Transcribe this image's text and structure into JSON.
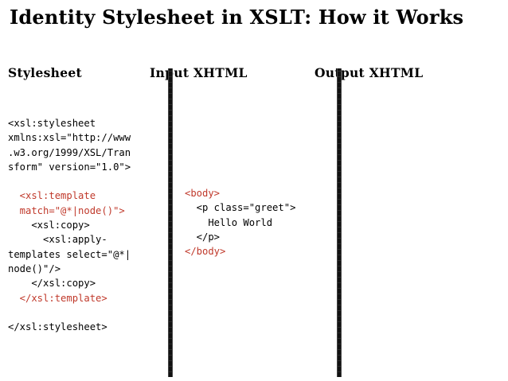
{
  "title": "Identity Stylesheet in XSLT: How it Works",
  "columns": {
    "stylesheet": "Stylesheet",
    "input": "Input XHTML",
    "output": "Output XHTML"
  },
  "stylesheet_code": [
    {
      "text": "<xsl:stylesheet",
      "highlight": false
    },
    {
      "text": "xmlns:xsl=\"http://www",
      "highlight": false
    },
    {
      "text": ".w3.org/1999/XSL/Tran",
      "highlight": false
    },
    {
      "text": "sform\" version=\"1.0\">",
      "highlight": false
    },
    {
      "text": "",
      "highlight": false
    },
    {
      "text": "  <xsl:template",
      "highlight": true
    },
    {
      "text": "  match=\"@*|node()\">",
      "highlight": true
    },
    {
      "text": "    <xsl:copy>",
      "highlight": false
    },
    {
      "text": "      <xsl:apply-",
      "highlight": false
    },
    {
      "text": "templates select=\"@*|",
      "highlight": false
    },
    {
      "text": "node()\"/>",
      "highlight": false
    },
    {
      "text": "    </xsl:copy>",
      "highlight": false
    },
    {
      "text": "  </xsl:template>",
      "highlight": true
    },
    {
      "text": "",
      "highlight": false
    },
    {
      "text": "</xsl:stylesheet>",
      "highlight": false
    }
  ],
  "input_code": [
    {
      "text": "<body>",
      "highlight": true
    },
    {
      "text": "  <p class=\"greet\">",
      "highlight": false
    },
    {
      "text": "    Hello World",
      "highlight": false
    },
    {
      "text": "  </p>",
      "highlight": false
    },
    {
      "text": "</body>",
      "highlight": true
    }
  ],
  "colors": {
    "highlight": "#c0392b",
    "text": "#000000",
    "background": "#ffffff"
  }
}
